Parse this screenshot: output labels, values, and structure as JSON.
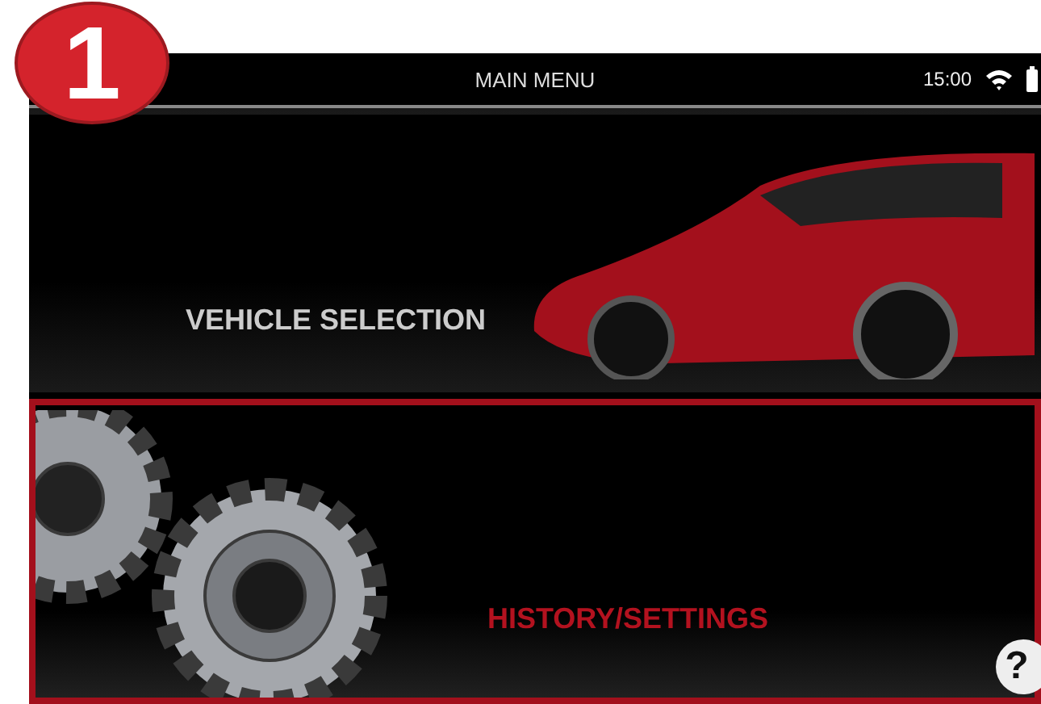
{
  "step_badge": "1",
  "status_bar": {
    "title": "MAIN MENU",
    "time": "15:00"
  },
  "menu_items": [
    {
      "kind": "vehicle",
      "label": "VEHICLE SELECTION",
      "selected": false
    },
    {
      "kind": "settings",
      "label": "HISTORY/SETTINGS",
      "selected": true
    }
  ],
  "help_button": "?"
}
